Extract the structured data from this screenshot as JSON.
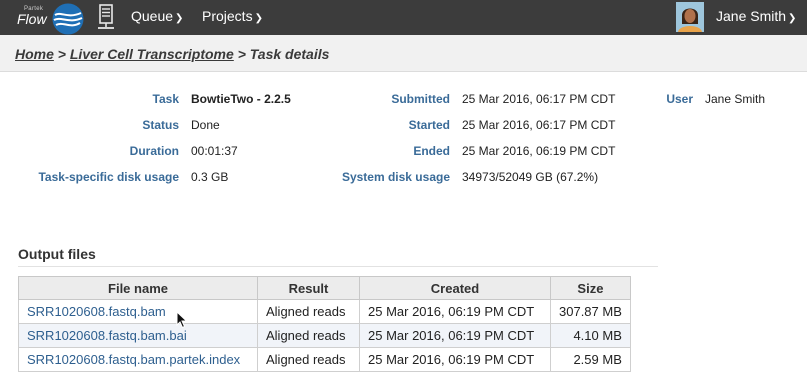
{
  "nav": {
    "logo_small": "Partek",
    "logo_text": "Flow",
    "menus": [
      {
        "label": "Queue"
      },
      {
        "label": "Projects"
      }
    ],
    "user_name": "Jane Smith"
  },
  "breadcrumb": {
    "home": "Home",
    "project": "Liver Cell Transcriptome",
    "separator": ">",
    "current": "Task details"
  },
  "details": {
    "task_label": "Task",
    "task_value": "BowtieTwo - 2.2.5",
    "status_label": "Status",
    "status_value": "Done",
    "duration_label": "Duration",
    "duration_value": "00:01:37",
    "disk_label": "Task-specific disk usage",
    "disk_value": "0.3 GB",
    "submitted_label": "Submitted",
    "submitted_value": "25 Mar 2016, 06:17 PM CDT",
    "started_label": "Started",
    "started_value": "25 Mar 2016, 06:17 PM CDT",
    "ended_label": "Ended",
    "ended_value": "25 Mar 2016, 06:19 PM CDT",
    "system_disk_label": "System disk usage",
    "system_disk_value": "34973/52049 GB (67.2%)",
    "user_label": "User",
    "user_value": "Jane Smith"
  },
  "output": {
    "title": "Output files",
    "columns": [
      "File name",
      "Result",
      "Created",
      "Size"
    ],
    "rows": [
      {
        "file": "SRR1020608.fastq.bam",
        "result": "Aligned reads",
        "created": "25 Mar 2016, 06:19 PM CDT",
        "size": "307.87 MB"
      },
      {
        "file": "SRR1020608.fastq.bam.bai",
        "result": "Aligned reads",
        "created": "25 Mar 2016, 06:19 PM CDT",
        "size": "4.10 MB"
      },
      {
        "file": "SRR1020608.fastq.bam.partek.index",
        "result": "Aligned reads",
        "created": "25 Mar 2016, 06:19 PM CDT",
        "size": "2.59 MB"
      }
    ]
  },
  "icons": {
    "logo": "partek-flow-logo",
    "server": "server-icon",
    "chevron": "chevron-down-icon",
    "avatar": "user-avatar",
    "cursor": "mouse-cursor"
  },
  "colors": {
    "nav_bg": "#3c3c3c",
    "label_blue": "#3a6b98",
    "link_blue": "#2e5f8f",
    "logo_blue": "#1f6fb5"
  }
}
